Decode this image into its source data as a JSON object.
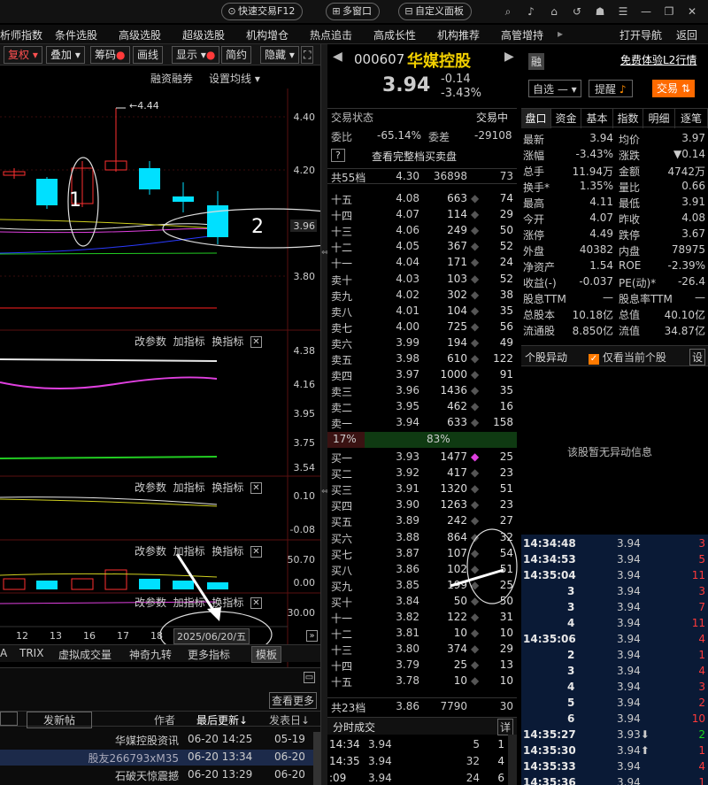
{
  "topbar": {
    "quick_trade": "快速交易F12",
    "multi_window": "多窗口",
    "custom_panel": "自定义面板"
  },
  "menu": [
    "析师指数",
    "条件选股",
    "高级选股",
    "超级选股",
    "机构增仓",
    "热点追击",
    "高成长性",
    "机构推荐",
    "高管增持",
    "打开导航",
    "返回"
  ],
  "chart_toolbar": {
    "fuquan": "复权",
    "overlay": "叠加",
    "chips": "筹码",
    "draw": "画线",
    "display": "显示",
    "simple": "简约",
    "hide": "隐藏"
  },
  "main_chart": {
    "financing": "融资融券",
    "set_ma": "设置均线",
    "high_label": "4.44",
    "axis": [
      "4.40",
      "4.20",
      "3.96",
      "3.80"
    ],
    "annotation_1": "1",
    "annotation_2": "2"
  },
  "sub_panel_labels": {
    "change_param": "改参数",
    "add_indicator": "加指标",
    "swap_indicator": "换指标",
    "close": "✕"
  },
  "sub1_axis": [
    "4.38",
    "4.16",
    "3.95",
    "3.75",
    "3.54"
  ],
  "sub2_axis": [
    "0.10",
    "-0.08"
  ],
  "sub3_axis": [
    "50.70",
    "0.00"
  ],
  "sub4_axis": [
    "30.00"
  ],
  "date_axis": [
    "12",
    "13",
    "16",
    "17",
    "18"
  ],
  "date_tooltip": "2025/06/20/五",
  "indicator_tabs": [
    "A",
    "TRIX",
    "虚拟成交量",
    "神奇九转",
    "更多指标",
    "模板"
  ],
  "news": {
    "view_more": "查看更多",
    "post": "发新帖",
    "col_author": "作者",
    "col_updated": "最后更新",
    "col_date": "发表日",
    "rows": [
      {
        "author": "华媒控股资讯",
        "time": "06-20 14:25",
        "date": "05-19"
      },
      {
        "author": "股友266793xM35",
        "time": "06-20 13:34",
        "date": "06-20"
      },
      {
        "author": "石破天惊震撼",
        "time": "06-20 13:29",
        "date": "06-20"
      }
    ]
  },
  "stock": {
    "code": "000607",
    "name": "华媒控股",
    "price": "3.94",
    "change": "-0.14",
    "pct": "-3.43%",
    "rong": "融",
    "l2": "免费体验L2行情",
    "watchlist": "自选",
    "alert": "提醒",
    "trade": "交易"
  },
  "orderbook": {
    "status_label": "交易状态",
    "status": "交易中",
    "ratio_label": "委比",
    "ratio": "-65.14%",
    "diff_label": "委差",
    "diff": "-29108",
    "help": "?",
    "query": "查看完整档买卖盘",
    "sell_total": {
      "label": "共55档",
      "price": "4.30",
      "vol": "36898",
      "n": "73"
    },
    "sells": [
      {
        "l": "十五",
        "p": "4.08",
        "v": "663",
        "n": "74"
      },
      {
        "l": "十四",
        "p": "4.07",
        "v": "114",
        "n": "29"
      },
      {
        "l": "十三",
        "p": "4.06",
        "v": "249",
        "n": "50"
      },
      {
        "l": "十二",
        "p": "4.05",
        "v": "367",
        "n": "52"
      },
      {
        "l": "十一",
        "p": "4.04",
        "v": "171",
        "n": "24"
      },
      {
        "l": "卖十",
        "p": "4.03",
        "v": "103",
        "n": "52"
      },
      {
        "l": "卖九",
        "p": "4.02",
        "v": "302",
        "n": "38"
      },
      {
        "l": "卖八",
        "p": "4.01",
        "v": "104",
        "n": "35"
      },
      {
        "l": "卖七",
        "p": "4.00",
        "v": "725",
        "n": "56"
      },
      {
        "l": "卖六",
        "p": "3.99",
        "v": "194",
        "n": "49"
      },
      {
        "l": "卖五",
        "p": "3.98",
        "v": "610",
        "n": "122"
      },
      {
        "l": "卖四",
        "p": "3.97",
        "v": "1000",
        "n": "91"
      },
      {
        "l": "卖三",
        "p": "3.96",
        "v": "1436",
        "n": "35"
      },
      {
        "l": "卖二",
        "p": "3.95",
        "v": "462",
        "n": "16"
      },
      {
        "l": "卖一",
        "p": "3.94",
        "v": "633",
        "n": "158"
      }
    ],
    "bar_left": "17%",
    "bar_right": "83%",
    "buys": [
      {
        "l": "买一",
        "p": "3.93",
        "v": "1477",
        "n": "25"
      },
      {
        "l": "买二",
        "p": "3.92",
        "v": "417",
        "n": "23"
      },
      {
        "l": "买三",
        "p": "3.91",
        "v": "1320",
        "n": "51"
      },
      {
        "l": "买四",
        "p": "3.90",
        "v": "1263",
        "n": "23"
      },
      {
        "l": "买五",
        "p": "3.89",
        "v": "242",
        "n": "27"
      },
      {
        "l": "买六",
        "p": "3.88",
        "v": "864",
        "n": "32"
      },
      {
        "l": "买七",
        "p": "3.87",
        "v": "107",
        "n": "54"
      },
      {
        "l": "买八",
        "p": "3.86",
        "v": "102",
        "n": "51"
      },
      {
        "l": "买九",
        "p": "3.85",
        "v": "199",
        "n": "25"
      },
      {
        "l": "买十",
        "p": "3.84",
        "v": "50",
        "n": "50"
      },
      {
        "l": "十一",
        "p": "3.82",
        "v": "122",
        "n": "31"
      },
      {
        "l": "十二",
        "p": "3.81",
        "v": "10",
        "n": "10"
      },
      {
        "l": "十三",
        "p": "3.80",
        "v": "374",
        "n": "29"
      },
      {
        "l": "十四",
        "p": "3.79",
        "v": "25",
        "n": "13"
      },
      {
        "l": "十五",
        "p": "3.78",
        "v": "10",
        "n": "10"
      }
    ],
    "buy_total": {
      "label": "共23档",
      "price": "3.86",
      "vol": "7790",
      "n": "30"
    },
    "ticks_title": "分时成交",
    "ticks_detail": "详",
    "ticks": [
      {
        "t": "14:34",
        "p": "3.94",
        "v": "5",
        "n": "1"
      },
      {
        "t": "14:35",
        "p": "3.94",
        "v": "32",
        "n": "4"
      },
      {
        "t": ":09",
        "p": "3.94",
        "v": "24",
        "n": "6"
      }
    ]
  },
  "tabs": [
    "盘口",
    "资金",
    "基本",
    "指数",
    "明细",
    "逐笔"
  ],
  "quote": [
    {
      "l": "最新",
      "v": "3.94",
      "l2": "均价",
      "v2": "3.97"
    },
    {
      "l": "涨幅",
      "v": "-3.43%",
      "l2": "涨跌",
      "v2": "▼0.14"
    },
    {
      "l": "总手",
      "v": "11.94万",
      "l2": "金额",
      "v2": "4742万"
    },
    {
      "l": "换手*",
      "v": "1.35%",
      "l2": "量比",
      "v2": "0.66"
    },
    {
      "l": "最高",
      "v": "4.11",
      "l2": "最低",
      "v2": "3.91"
    },
    {
      "l": "今开",
      "v": "4.07",
      "l2": "昨收",
      "v2": "4.08"
    },
    {
      "l": "涨停",
      "v": "4.49",
      "l2": "跌停",
      "v2": "3.67"
    },
    {
      "l": "外盘",
      "v": "40382",
      "l2": "内盘",
      "v2": "78975"
    },
    {
      "l": "净资产",
      "v": "1.54",
      "l2": "ROE",
      "v2": "-2.39%"
    },
    {
      "l": "收益(-)",
      "v": "-0.037",
      "l2": "PE(动)*",
      "v2": "-26.4"
    },
    {
      "l": "股息TTM",
      "v": "—",
      "l2": "股息率TTM",
      "v2": "—"
    },
    {
      "l": "总股本",
      "v": "10.18亿",
      "l2": "总值",
      "v2": "40.10亿"
    },
    {
      "l": "流通股",
      "v": "8.850亿",
      "l2": "流值",
      "v2": "34.87亿"
    }
  ],
  "anomaly": {
    "title": "个股异动",
    "only_current": "仅看当前个股",
    "settings": "设",
    "empty": "该股暂无异动信息"
  },
  "trades": [
    {
      "t": "14:34:48",
      "p": "3.94",
      "v": "3"
    },
    {
      "t": "14:34:53",
      "p": "3.94",
      "v": "5"
    },
    {
      "t": "14:35:04",
      "p": "3.94",
      "v": "11"
    },
    {
      "t": "3",
      "p": "3.94",
      "v": "3"
    },
    {
      "t": "3",
      "p": "3.94",
      "v": "7"
    },
    {
      "t": "4",
      "p": "3.94",
      "v": "11"
    },
    {
      "t": "14:35:06",
      "p": "3.94",
      "v": "4"
    },
    {
      "t": "2",
      "p": "3.94",
      "v": "1"
    },
    {
      "t": "3",
      "p": "3.94",
      "v": "4"
    },
    {
      "t": "4",
      "p": "3.94",
      "v": "3"
    },
    {
      "t": "5",
      "p": "3.94",
      "v": "2"
    },
    {
      "t": "6",
      "p": "3.94",
      "v": "10"
    },
    {
      "t": "14:35:27",
      "p": "3.93⬇",
      "v": "2"
    },
    {
      "t": "14:35:30",
      "p": "3.94⬆",
      "v": "1"
    },
    {
      "t": "14:35:33",
      "p": "3.94",
      "v": "4"
    },
    {
      "t": "14:35:36",
      "p": "3.94",
      "v": "1"
    }
  ]
}
